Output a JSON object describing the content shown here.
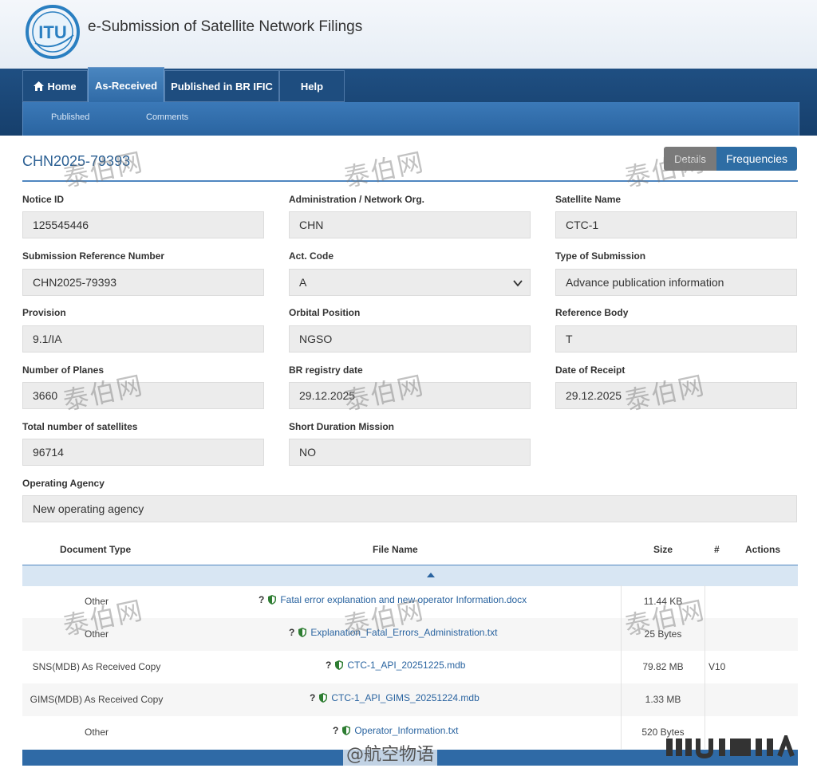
{
  "header": {
    "logo_text": "ITU",
    "app_title": "e-Submission of Satellite Network Filings"
  },
  "nav": {
    "tabs": [
      {
        "label": "Home",
        "icon": "home-icon"
      },
      {
        "label": "As-Received"
      },
      {
        "label": "Published in BR IFIC"
      },
      {
        "label": "Help"
      }
    ],
    "active_tab": "As-Received",
    "subtabs": [
      "Published",
      "Comments"
    ]
  },
  "record": {
    "title": "CHN2025-79393",
    "buttons": {
      "details": "Details",
      "frequencies": "Frequencies"
    }
  },
  "form": {
    "notice_id": {
      "label": "Notice ID",
      "value": "125545446"
    },
    "administration": {
      "label": "Administration / Network Org.",
      "value": "CHN"
    },
    "satellite_name": {
      "label": "Satellite Name",
      "value": "CTC-1"
    },
    "submission_ref": {
      "label": "Submission Reference Number",
      "value": "CHN2025-79393"
    },
    "act_code": {
      "label": "Act. Code",
      "value": "A"
    },
    "type_of_submission": {
      "label": "Type of Submission",
      "value": "Advance publication information"
    },
    "provision": {
      "label": "Provision",
      "value": "9.1/IA"
    },
    "orbital_position": {
      "label": "Orbital Position",
      "value": "NGSO"
    },
    "reference_body": {
      "label": "Reference Body",
      "value": "T"
    },
    "number_of_planes": {
      "label": "Number of Planes",
      "value": "3660"
    },
    "br_registry_date": {
      "label": "BR registry date",
      "value": "29.12.2025"
    },
    "date_of_receipt": {
      "label": "Date of Receipt",
      "value": "29.12.2025"
    },
    "total_satellites": {
      "label": "Total number of satellites",
      "value": "96714"
    },
    "short_duration": {
      "label": "Short Duration Mission",
      "value": "NO"
    },
    "operating_agency": {
      "label": "Operating Agency",
      "value": "New operating agency"
    }
  },
  "documents": {
    "columns": [
      "Document Type",
      "File Name",
      "Size",
      "#",
      "Actions"
    ],
    "rows": [
      {
        "type": "Other",
        "file": "Fatal error explanation and new operator Information.docx",
        "size": "11.44 KB",
        "version": ""
      },
      {
        "type": "Other",
        "file": "Explanation_Fatal_Errors_Administration.txt",
        "size": "25 Bytes",
        "version": ""
      },
      {
        "type": "SNS(MDB) As Received Copy",
        "file": "CTC-1_API_20251225.mdb",
        "size": "79.82 MB",
        "version": "V10"
      },
      {
        "type": "GIMS(MDB) As Received Copy",
        "file": "CTC-1_API_GIMS_20251224.mdb",
        "size": "1.33 MB",
        "version": ""
      },
      {
        "type": "Other",
        "file": "Operator_Information.txt",
        "size": "520 Bytes",
        "version": ""
      }
    ],
    "help_glyph": "?"
  },
  "overlay": {
    "watermark": "泰伯网",
    "credit": "@航空物语"
  },
  "colors": {
    "nav_dark": "#1f4f82",
    "accent_blue": "#2e6da4",
    "link_blue": "#2a64a0",
    "field_bg": "#ececec",
    "shield_green": "#2e7d32"
  }
}
